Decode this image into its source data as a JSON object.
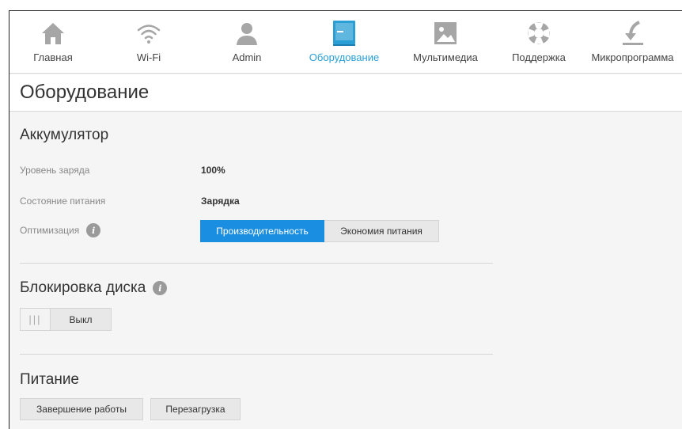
{
  "nav": {
    "items": [
      {
        "label": "Главная",
        "icon": "home-icon"
      },
      {
        "label": "Wi-Fi",
        "icon": "wifi-icon"
      },
      {
        "label": "Admin",
        "icon": "user-icon"
      },
      {
        "label": "Оборудование",
        "icon": "hardware-icon"
      },
      {
        "label": "Мультимедиа",
        "icon": "image-icon"
      },
      {
        "label": "Поддержка",
        "icon": "lifebuoy-icon"
      },
      {
        "label": "Микропрограмма",
        "icon": "download-arrow-icon"
      }
    ],
    "active_index": 3,
    "colors": {
      "icon": "#a6a6a6",
      "active": "#2a9fd6"
    }
  },
  "page": {
    "title": "Оборудование"
  },
  "battery": {
    "title": "Аккумулятор",
    "charge_label": "Уровень заряда",
    "charge_value": "100%",
    "power_label": "Состояние питания",
    "power_value": "Зарядка",
    "optimization_label": "Оптимизация",
    "options": [
      "Производительность",
      "Экономия питания"
    ],
    "selected_option": 0
  },
  "disk_lock": {
    "title": "Блокировка диска",
    "toggle_label": "Выкл"
  },
  "power": {
    "title": "Питание",
    "shutdown_label": "Завершение работы",
    "reboot_label": "Перезагрузка"
  },
  "colors": {
    "accent": "#1a8ee0",
    "background": "#f5f5f5"
  }
}
